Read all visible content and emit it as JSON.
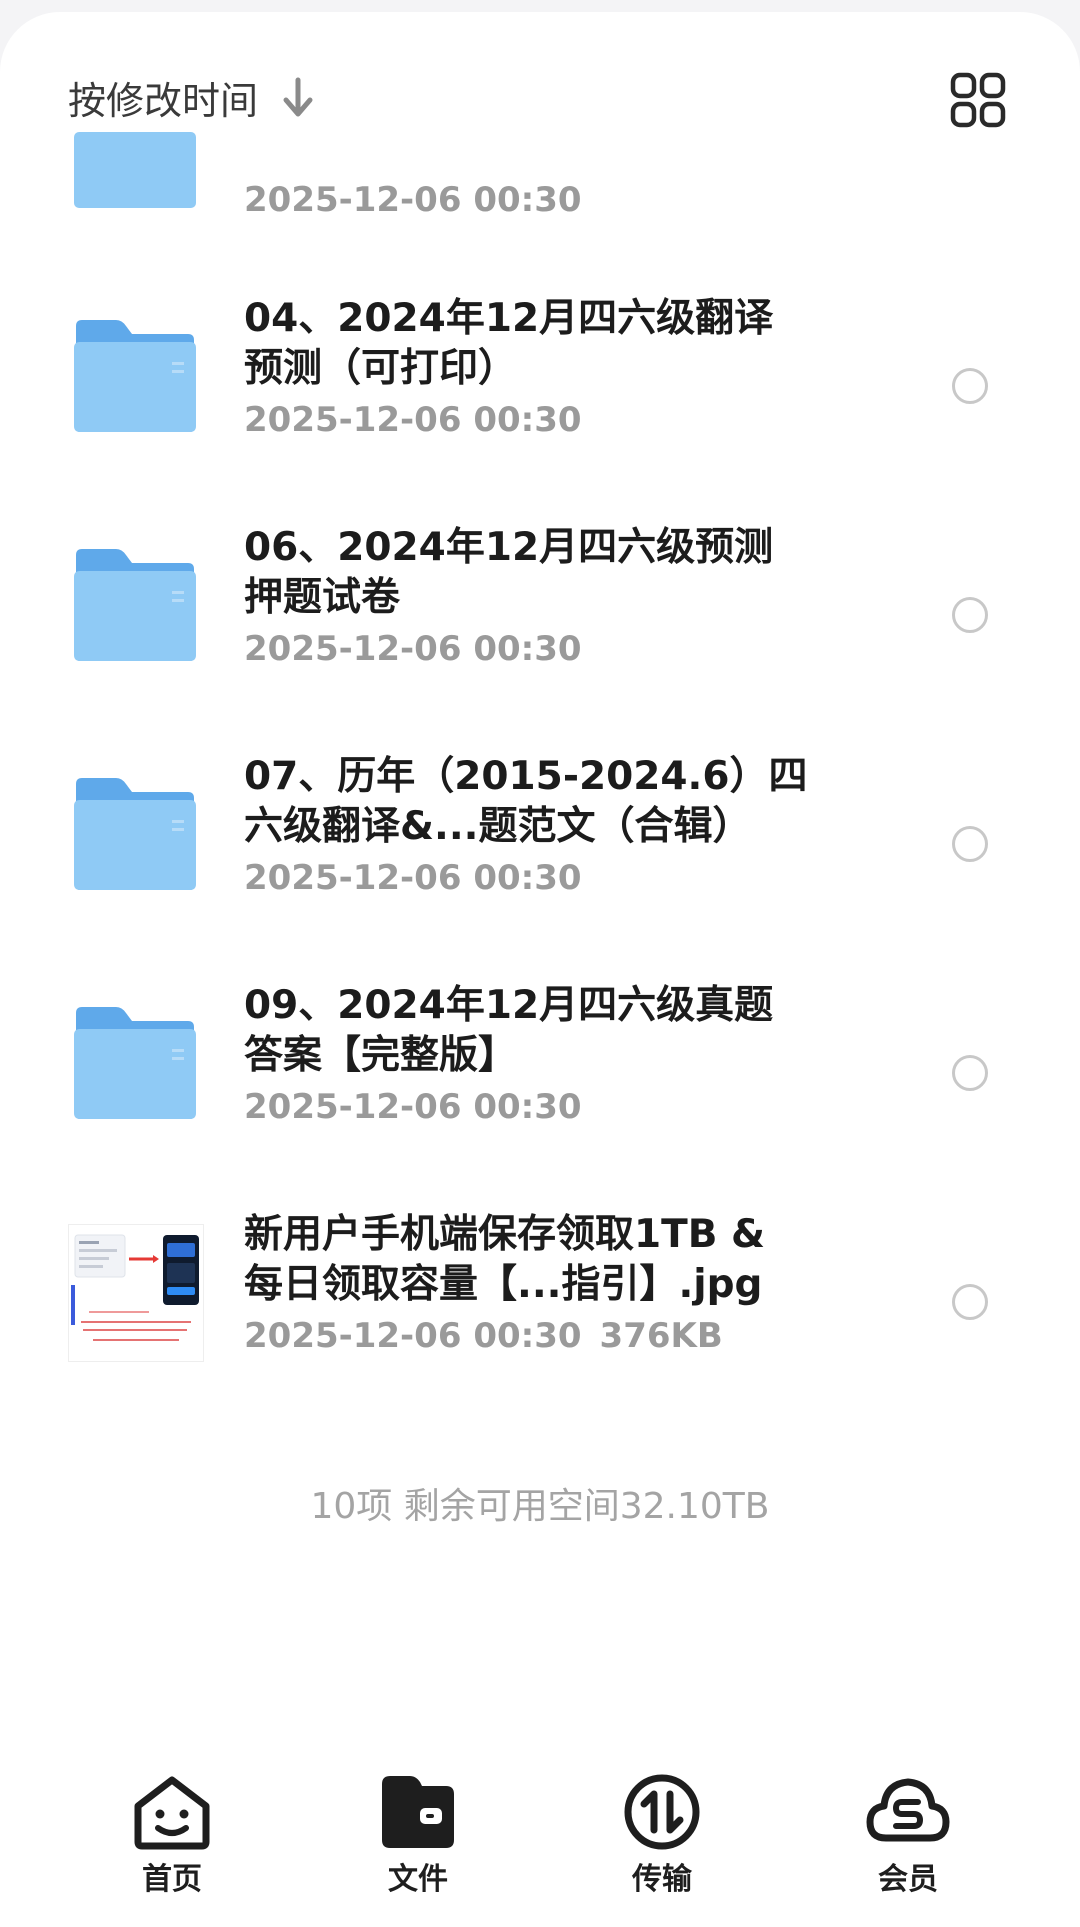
{
  "toolbar": {
    "sort_label": "按修改时间",
    "sort_arrow_icon": "arrow-down-icon",
    "view_toggle_icon": "grid-view-icon"
  },
  "files": [
    {
      "name": "",
      "date": "2025-12-06 00:30",
      "size": "",
      "type": "folder"
    },
    {
      "name_line1": "04、2024年12月四六级翻译",
      "name_line2": "预测（可打印）",
      "date": "2025-12-06 00:30",
      "size": "",
      "type": "folder"
    },
    {
      "name_line1": "06、2024年12月四六级预测",
      "name_line2": "押题试卷",
      "date": "2025-12-06 00:30",
      "size": "",
      "type": "folder"
    },
    {
      "name_line1": "07、历年（2015-2024.6）四",
      "name_line2": "六级翻译&...题范文（合辑）",
      "date": "2025-12-06 00:30",
      "size": "",
      "type": "folder"
    },
    {
      "name_line1": "09、2024年12月四六级真题",
      "name_line2": "答案【完整版】",
      "date": "2025-12-06 00:30",
      "size": "",
      "type": "folder"
    },
    {
      "name_line1": "新用户手机端保存领取1TB &",
      "name_line2": "每日领取容量【...指引】.jpg",
      "date": "2025-12-06 00:30",
      "size": "376KB",
      "type": "image"
    }
  ],
  "summary": "10项 剩余可用空间32.10TB",
  "tabs": [
    {
      "label": "首页",
      "icon": "home-smile-icon"
    },
    {
      "label": "文件",
      "icon": "wallet-folder-icon"
    },
    {
      "label": "传输",
      "icon": "transfer-icon"
    },
    {
      "label": "会员",
      "icon": "cloud-member-icon"
    }
  ],
  "colors": {
    "folder_front": "#8fcaf5",
    "folder_back": "#5fa9ea",
    "text_primary": "#1c1c1c",
    "text_secondary": "#9a9a9a"
  }
}
